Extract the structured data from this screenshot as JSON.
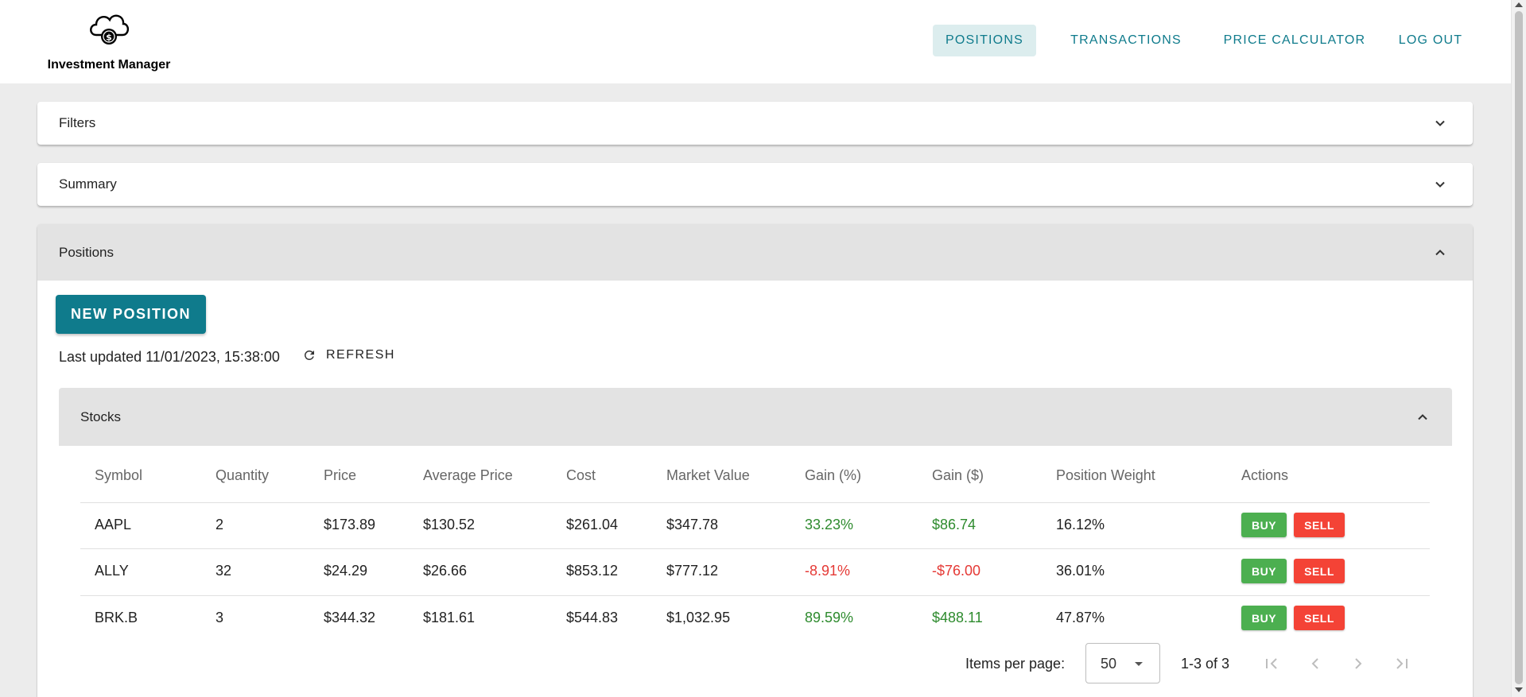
{
  "app": {
    "title": "Investment Manager"
  },
  "nav": {
    "positions": "POSITIONS",
    "transactions": "TRANSACTIONS",
    "price_calculator": "PRICE CALCULATOR",
    "logout": "LOG OUT"
  },
  "panels": {
    "filters": "Filters",
    "summary": "Summary",
    "positions": "Positions"
  },
  "positions": {
    "new_button": "NEW POSITION",
    "last_updated": "Last updated 11/01/2023, 15:38:00",
    "refresh": "REFRESH"
  },
  "stocks": {
    "title": "Stocks",
    "columns": [
      "Symbol",
      "Quantity",
      "Price",
      "Average Price",
      "Cost",
      "Market Value",
      "Gain (%)",
      "Gain ($)",
      "Position Weight",
      "Actions"
    ],
    "rows": [
      {
        "symbol": "AAPL",
        "quantity": "2",
        "price": "$173.89",
        "avg_price": "$130.52",
        "cost": "$261.04",
        "market_value": "$347.78",
        "gain_pct": "33.23%",
        "gain_usd": "$86.74",
        "weight": "16.12%",
        "buy": "BUY",
        "sell": "SELL"
      },
      {
        "symbol": "ALLY",
        "quantity": "32",
        "price": "$24.29",
        "avg_price": "$26.66",
        "cost": "$853.12",
        "market_value": "$777.12",
        "gain_pct": "-8.91%",
        "gain_usd": "-$76.00",
        "weight": "36.01%",
        "buy": "BUY",
        "sell": "SELL"
      },
      {
        "symbol": "BRK.B",
        "quantity": "3",
        "price": "$344.32",
        "avg_price": "$181.61",
        "cost": "$544.83",
        "market_value": "$1,032.95",
        "gain_pct": "89.59%",
        "gain_usd": "$488.11",
        "weight": "47.87%",
        "buy": "BUY",
        "sell": "SELL"
      }
    ]
  },
  "pagination": {
    "items_per_page_label": "Items per page:",
    "items_per_page": "50",
    "range": "1-3 of 3"
  },
  "colors": {
    "accent": "#0f7b8c",
    "nav_active_bg": "#dcedee",
    "positive": "#2e8b2e",
    "negative": "#e53935",
    "buy": "#4caf50",
    "sell": "#f44336"
  },
  "icons": {
    "logo": "cloud-dollar-icon",
    "expand": "chevron-down-icon",
    "collapse": "chevron-up-icon",
    "refresh": "refresh-icon",
    "first_page": "first-page-icon",
    "prev_page": "chevron-left-icon",
    "next_page": "chevron-right-icon",
    "last_page": "last-page-icon"
  }
}
